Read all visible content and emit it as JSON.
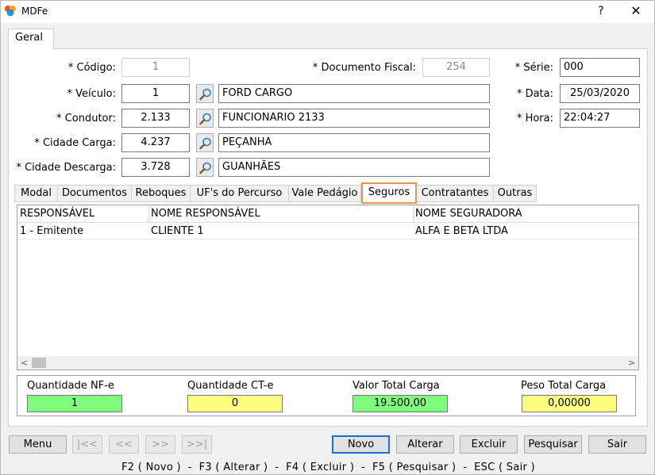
{
  "window": {
    "title": "MDFe",
    "help_label": "?",
    "close_label": "✕"
  },
  "main_tab": {
    "label": "Geral"
  },
  "form": {
    "codigo": {
      "label": "* Código:",
      "value": "1"
    },
    "documento_fiscal": {
      "label": "* Documento Fiscal:",
      "value": "254"
    },
    "serie": {
      "label": "* Série:",
      "value": "000"
    },
    "veiculo": {
      "label": "* Veículo:",
      "code": "1",
      "name": "FORD CARGO"
    },
    "data": {
      "label": "* Data:",
      "value": "25/03/2020"
    },
    "condutor": {
      "label": "* Condutor:",
      "code": "2.133",
      "name": "FUNCIONARIO 2133"
    },
    "hora": {
      "label": "* Hora:",
      "value": "22:04:27"
    },
    "cidade_carga": {
      "label": "* Cidade Carga:",
      "code": "4.237",
      "name": "PEÇANHA"
    },
    "cidade_descarga": {
      "label": "* Cidade Descarga:",
      "code": "3.728",
      "name": "GUANHÃES"
    }
  },
  "subtabs": [
    "Modal",
    "Documentos",
    "Reboques",
    "UF's do Percurso",
    "Vale Pedágio",
    "Seguros",
    "Contratantes",
    "Outras"
  ],
  "active_subtab": "Seguros",
  "grid": {
    "columns": [
      "RESPONSÁVEL",
      "NOME RESPONSÁVEL",
      "NOME SEGURADORA"
    ],
    "rows": [
      {
        "responsavel": "1 - Emitente",
        "nome_responsavel": "CLIENTE 1",
        "nome_seguradora": "ALFA E BETA LTDA"
      }
    ],
    "scroll_left": "<",
    "scroll_right": ">"
  },
  "totals": {
    "qtd_nfe": {
      "label": "Quantidade NF-e",
      "value": "1"
    },
    "qtd_cte": {
      "label": "Quantidade CT-e",
      "value": "0"
    },
    "valor_total": {
      "label": "Valor Total Carga",
      "value": "19.500,00"
    },
    "peso_total": {
      "label": "Peso Total Carga",
      "value": "0,00000"
    }
  },
  "buttons": {
    "menu": "Menu",
    "first": "|<<",
    "prev": "<<",
    "next": ">>",
    "last": ">>|",
    "novo": "Novo",
    "alterar": "Alterar",
    "excluir": "Excluir",
    "pesquisar": "Pesquisar",
    "sair": "Sair"
  },
  "shortcuts": "F2 ( Novo )  -  F3 ( Alterar )  -  F4 ( Excluir )  -  F5 ( Pesquisar )  -  ESC ( Sair )",
  "colors": {
    "green_field": "#7dfc7d",
    "yellow_field": "#fdfd80",
    "active_tab_border": "#e8954a",
    "default_button_border": "#1c6fd4"
  }
}
